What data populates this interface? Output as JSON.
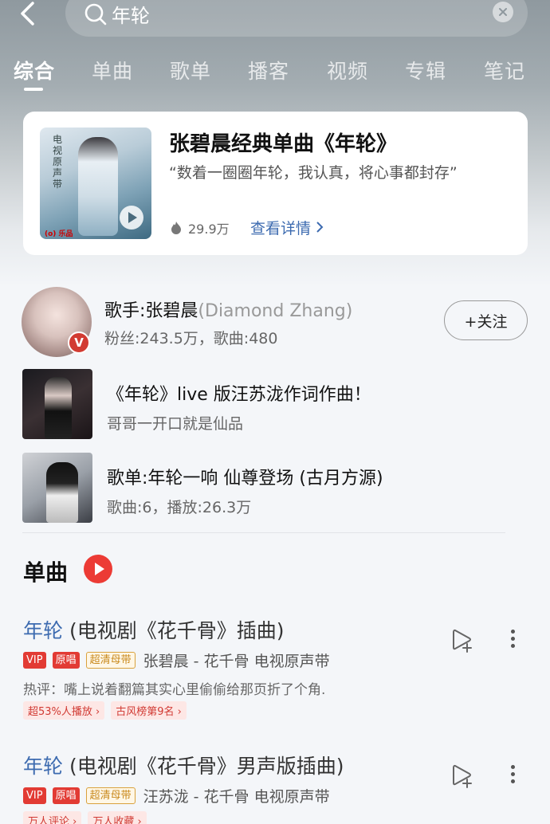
{
  "search": {
    "query": "年轮"
  },
  "tabs": [
    "综合",
    "单曲",
    "歌单",
    "播客",
    "视频",
    "专辑",
    "笔记"
  ],
  "feature": {
    "title": "张碧晨经典单曲《年轮》",
    "quote": "“数着一圈圈年轮，我认真，将心事都封存”",
    "plays": "29.9万",
    "detail": "查看详情",
    "cover_text": "电视原声带",
    "cover_logo": "(o) 乐品"
  },
  "artist": {
    "name": "歌手:张碧晨",
    "name_en": "(Diamond Zhang)",
    "meta": "粉丝:243.5万，歌曲:480",
    "follow": "+关注",
    "badge": "V"
  },
  "rows": [
    {
      "title": "《年轮》live 版汪苏泷作词作曲！",
      "sub": "哥哥一开口就是仙品"
    },
    {
      "title": "歌单:年轮一响 仙尊登场 (古月方源)",
      "sub": "歌曲:6，播放:26.3万"
    }
  ],
  "section": {
    "title": "单曲"
  },
  "songs": [
    {
      "title_hl": "年轮",
      "title_rest": " (电视剧《花千骨》插曲)",
      "tags": [
        "VIP",
        "原唱",
        "超清母带"
      ],
      "artist": "张碧晨 - 花千骨 电视原声带",
      "comment": "热评：嘴上说着翻篇其实心里偷偷给那页折了个角.",
      "badges": [
        "超53%人播放 ›",
        "古风榜第9名 ›"
      ]
    },
    {
      "title_hl": "年轮",
      "title_rest": " (电视剧《花千骨》男声版插曲)",
      "tags": [
        "VIP",
        "原唱",
        "超清母带"
      ],
      "artist": "汪苏泷 - 花千骨 电视原声带",
      "comment": "",
      "badges": [
        "万人评论 ›",
        "万人收藏 ›"
      ]
    }
  ],
  "colors": {
    "accent": "#ec3b35",
    "link": "#3d6bb0"
  }
}
